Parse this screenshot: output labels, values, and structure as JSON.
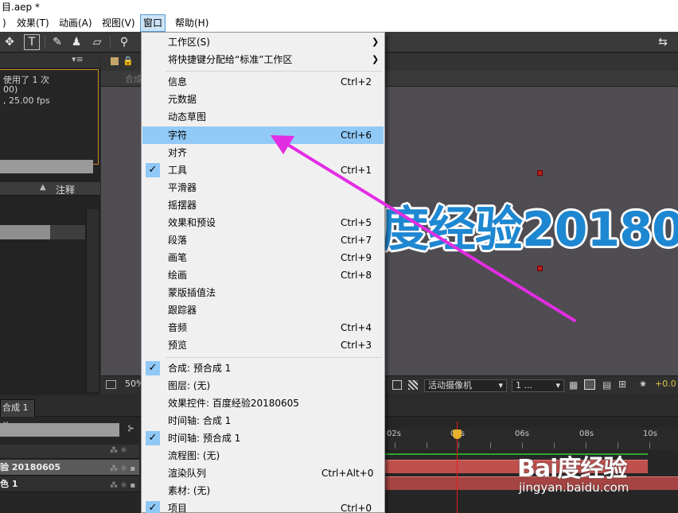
{
  "window": {
    "title": "目.aep *"
  },
  "menubar": {
    "items": [
      {
        "label": ")"
      },
      {
        "label": "效果(T)"
      },
      {
        "label": "动画(A)"
      },
      {
        "label": "视图(V)"
      },
      {
        "label": "窗口"
      },
      {
        "label": "帮助(H)"
      }
    ]
  },
  "project_panel": {
    "used_text": "使用了 1 次",
    "line2": "00)",
    "line3": ", 25.00 fps",
    "comment_header": "注释"
  },
  "comp_panel": {
    "tab_label": "合成",
    "canvas_text": "度经验20180",
    "zoom": "50%",
    "camera": "活动摄像机",
    "views": "1 ...",
    "exposure": "+0.0"
  },
  "timeline": {
    "tab_label": "合成 1",
    "layers": [
      {
        "name": "验 20180605"
      },
      {
        "name": "色 1"
      }
    ],
    "ruler_labels": [
      "02s",
      "04s",
      "06s",
      "08s",
      "10s"
    ]
  },
  "window_menu": {
    "items": [
      {
        "label": "工作区(S)",
        "submenu": true
      },
      {
        "label": "将快捷键分配给“标准”工作区",
        "submenu": true
      },
      {
        "label": "信息",
        "shortcut": "Ctrl+2"
      },
      {
        "label": "元数据"
      },
      {
        "label": "动态草图"
      },
      {
        "label": "字符",
        "shortcut": "Ctrl+6",
        "highlighted": true
      },
      {
        "label": "对齐"
      },
      {
        "label": "工具",
        "shortcut": "Ctrl+1",
        "checked": true
      },
      {
        "label": "平滑器"
      },
      {
        "label": "摇摆器"
      },
      {
        "label": "效果和预设",
        "shortcut": "Ctrl+5"
      },
      {
        "label": "段落",
        "shortcut": "Ctrl+7"
      },
      {
        "label": "画笔",
        "shortcut": "Ctrl+9"
      },
      {
        "label": "绘画",
        "shortcut": "Ctrl+8"
      },
      {
        "label": "蒙版插值法"
      },
      {
        "label": "跟踪器"
      },
      {
        "label": "音频",
        "shortcut": "Ctrl+4"
      },
      {
        "label": "预览",
        "shortcut": "Ctrl+3"
      },
      {
        "label": "合成: 预合成 1",
        "checked": true
      },
      {
        "label": "图层: (无)"
      },
      {
        "label": "效果控件: 百度经验20180605"
      },
      {
        "label": "时间轴: 合成 1"
      },
      {
        "label": "时间轴: 预合成 1",
        "checked": true
      },
      {
        "label": "流程图: (无)"
      },
      {
        "label": "渲染队列",
        "shortcut": "Ctrl+Alt+0"
      },
      {
        "label": "素材: (无)"
      },
      {
        "label": "项目",
        "shortcut": "Ctrl+0",
        "checked": true
      }
    ]
  },
  "watermark": {
    "logo": "Bai度经验",
    "url": "jingyan.baidu.com"
  },
  "colors": {
    "highlight": "#91c9f7",
    "annotation_arrow": "#e32de3",
    "canvas_text": "#1e87d1"
  }
}
